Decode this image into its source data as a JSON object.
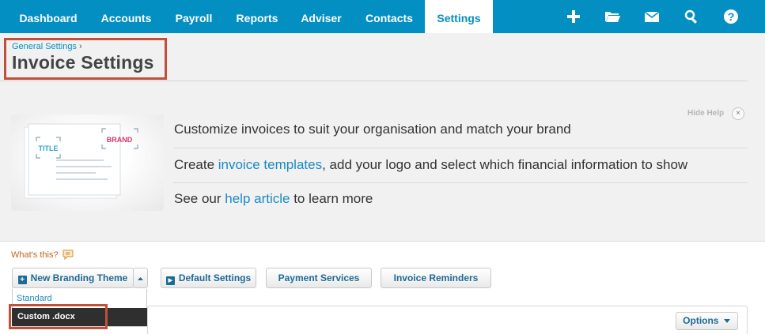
{
  "nav": {
    "items": [
      "Dashboard",
      "Accounts",
      "Payroll",
      "Reports",
      "Adviser",
      "Contacts",
      "Settings"
    ],
    "active": "Settings",
    "icons": [
      "plus-icon",
      "folder-icon",
      "mail-icon",
      "search-icon",
      "help-icon"
    ]
  },
  "header": {
    "breadcrumb": "General Settings",
    "breadcrumb_sep": "›",
    "title": "Invoice Settings"
  },
  "help": {
    "hide_label": "Hide Help",
    "close_glyph": "×",
    "art_title": "TITLE",
    "art_brand": "BRAND",
    "line1": "Customize invoices to suit your organisation and match your brand",
    "line2_pre": "Create ",
    "line2_link": "invoice templates",
    "line2_post": ", add your logo and select which financial information to show",
    "line3_pre": "See our ",
    "line3_link": "help article",
    "line3_post": " to learn more"
  },
  "toolbar": {
    "whats_this": "What's this?",
    "new_theme": "New Branding Theme",
    "default_settings": "Default Settings",
    "payment_services": "Payment Services",
    "invoice_reminders": "Invoice Reminders",
    "options": "Options"
  },
  "dropdown": {
    "standard": "Standard",
    "custom": "Custom .docx"
  },
  "colors": {
    "brand_blue": "#048fc2",
    "highlight": "#c0503a",
    "brand_pink": "#d6336c"
  }
}
